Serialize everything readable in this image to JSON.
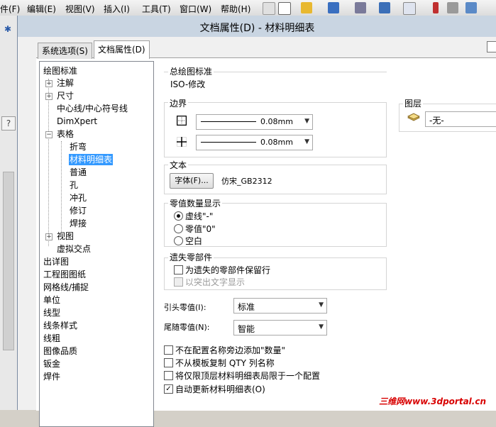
{
  "app_menu": {
    "items": [
      "件(F)",
      "编辑(E)",
      "视图(V)",
      "插入(I)",
      "工具(T)",
      "窗口(W)",
      "帮助(H)"
    ],
    "side_buttons": [
      "✱",
      "?"
    ]
  },
  "dialog": {
    "title": "文档属性(D) - 材料明细表",
    "tabs": {
      "system": "系统选项(S)",
      "document": "文档属性(D)"
    }
  },
  "tree": {
    "items": {
      "drawing_standard": "绘图标准",
      "annotations": "注解",
      "dimensions": "尺寸",
      "centerlines": "中心线/中心符号线",
      "dimxpert": "DimXpert",
      "tables": "表格",
      "bend": "折弯",
      "bom": "材料明细表",
      "general": "普通",
      "hole": "孔",
      "punch": "冲孔",
      "revision": "修订",
      "weld": "焊接",
      "views": "视图",
      "virtual_sharps": "虚拟交点",
      "detailing": "出详图",
      "drawing_sheets": "工程图图纸",
      "grid_snap": "网格线/捕捉",
      "units": "单位",
      "line_font": "线型",
      "line_style": "线条样式",
      "line_thickness": "线粗",
      "image_quality": "图像品质",
      "sheet_metal": "钣金",
      "weldments": "焊件"
    }
  },
  "panel": {
    "overall_standard": {
      "title": "总绘图标准",
      "value": "ISO-修改"
    },
    "border": {
      "title": "边界",
      "outer_thickness": "0.08mm",
      "inner_thickness": "0.08mm"
    },
    "layer": {
      "title": "图层",
      "value": "-无-"
    },
    "text": {
      "title": "文本",
      "font_button": "字体(F)...",
      "font_name": "仿宋_GB2312"
    },
    "zero_qty": {
      "title": "零值数量显示",
      "options": [
        "虚线\"-\"",
        "零值\"0\"",
        "空白"
      ],
      "selected": 0
    },
    "missing": {
      "title": "遗失零部件",
      "keep_row": "为遗失的零部件保留行",
      "strikeout": "以突出文字显示"
    },
    "leading_zeros": {
      "label": "引头零值(I):",
      "value": "标准"
    },
    "trailing_zeros": {
      "label": "尾随零值(N):",
      "value": "智能"
    },
    "checkboxes": {
      "no_qty_next_config": "不在配置名称旁边添加\"数量\"",
      "no_copy_qty": "不从模板复制 QTY 列名称",
      "restrict_top_level": "将仅限顶层材料明细表局限于一个配置",
      "auto_update": "自动更新材料明细表(O)"
    },
    "checked": {
      "no_qty_next_config": false,
      "no_copy_qty": false,
      "restrict_top_level": false,
      "auto_update": true
    }
  },
  "watermark": "三维网www.3dportal.cn",
  "colors": {
    "selection": "#3399ff",
    "title_bar": "#c9d5e2",
    "watermark": "#d80000"
  }
}
